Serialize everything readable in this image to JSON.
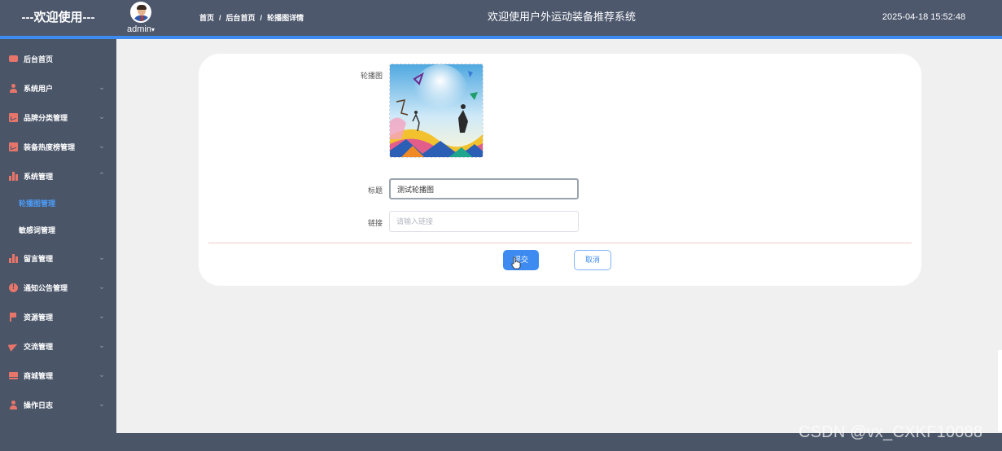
{
  "header": {
    "welcome": "---欢迎使用---",
    "username": "admin",
    "breadcrumb": [
      "首页",
      "后台首页",
      "轮播图详情"
    ],
    "breadcrumb_sep": "/",
    "system_title": "欢迎使用户外运动装备推荐系统",
    "datetime": "2025-04-18 15:52:48"
  },
  "sidebar": {
    "items": [
      {
        "label": "后台首页",
        "icon": "monitor-icon"
      },
      {
        "label": "系统用户",
        "icon": "user-icon"
      },
      {
        "label": "品牌分类管理",
        "icon": "chart-icon"
      },
      {
        "label": "装备热度榜管理",
        "icon": "chart-icon"
      },
      {
        "label": "系统管理",
        "icon": "bar-chart-icon",
        "expanded": true
      },
      {
        "label": "留言管理",
        "icon": "bar-chart-icon"
      },
      {
        "label": "通知公告管理",
        "icon": "alert-icon"
      },
      {
        "label": "资源管理",
        "icon": "flag-icon"
      },
      {
        "label": "交流管理",
        "icon": "send-icon"
      },
      {
        "label": "商城管理",
        "icon": "shop-icon"
      },
      {
        "label": "操作日志",
        "icon": "user-icon"
      }
    ],
    "sub_items": [
      {
        "label": "轮播图管理",
        "active": true
      },
      {
        "label": "敏感词管理",
        "active": false
      }
    ]
  },
  "form": {
    "image_label": "轮播图",
    "title_label": "标题",
    "title_value": "测试轮播图",
    "link_label": "链接",
    "link_placeholder": "请输入链接",
    "submit_label": "提交",
    "cancel_label": "取消"
  },
  "watermark": "CSDN @vx_CXKF10088",
  "colors": {
    "header_bg": "#4d586d",
    "accent": "#3d8bf0",
    "sidebar_bg": "#4a5568",
    "icon": "#e8756a",
    "active_sub": "#4d9cf8"
  }
}
